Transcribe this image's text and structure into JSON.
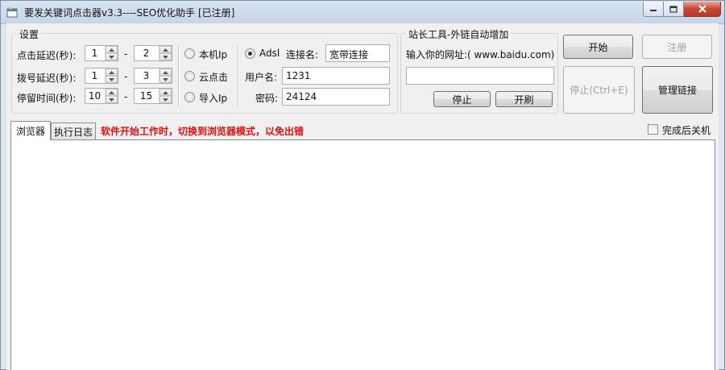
{
  "window": {
    "title": "要发关键词点击器v3.3----SEO优化助手  [已注册]"
  },
  "settings": {
    "legend": "设置",
    "click_delay_label": "点击延迟(秒):",
    "click_delay_min": "1",
    "click_delay_max": "2",
    "dial_delay_label": "拨号延迟(秒):",
    "dial_delay_min": "1",
    "dial_delay_max": "3",
    "stay_time_label": "停留时间(秒):",
    "stay_time_min": "10",
    "stay_time_max": "15",
    "range_sep": "-",
    "ip_modes": [
      "本机Ip",
      "云点击",
      "导入Ip",
      "Adsl"
    ],
    "selected_ip_mode": "Adsl",
    "connection_label": "连接名:",
    "connection_value": "宽带连接",
    "username_label": "用户名:",
    "username_value": "1231",
    "password_label": "密码:",
    "password_value": "24124"
  },
  "webmaster": {
    "legend": "站长工具-外链自动增加",
    "url_prompt": "输入你的网址:( www.baidu.com)",
    "url_value": "",
    "stop_label": "停止",
    "start_label": "开刷"
  },
  "actions": {
    "start_label": "开始",
    "register_label": "注册",
    "stop_label": "停止(Ctrl+E)",
    "manage_links_label": "管理链接"
  },
  "tabs": [
    {
      "label": "浏览器",
      "active": true
    },
    {
      "label": "执行日志",
      "active": false
    }
  ],
  "warning_text": "软件开始工作时，切换到浏览器模式，以免出错",
  "shutdown_label": "完成后关机",
  "shutdown_checked": false,
  "colors": {
    "warning": "#e01010"
  }
}
